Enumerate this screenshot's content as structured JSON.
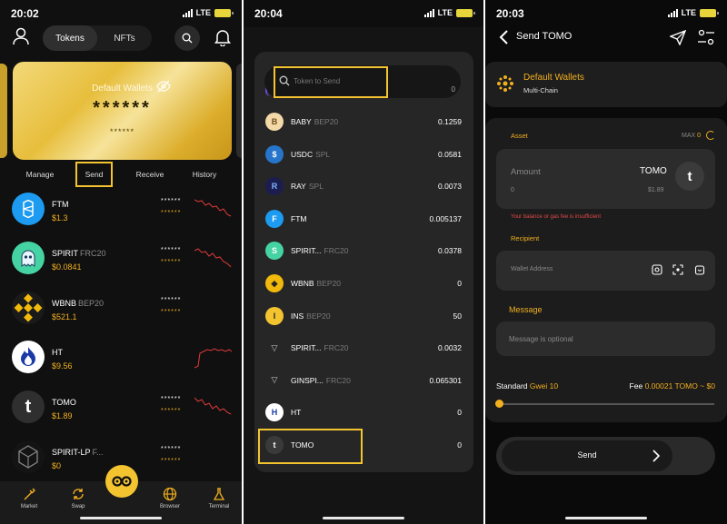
{
  "screen1": {
    "status": {
      "time": "20:02",
      "network": "LTE"
    },
    "tabs": [
      {
        "label": "Tokens"
      },
      {
        "label": "NFTs"
      }
    ],
    "card": {
      "wallet_name": "Default Wallets",
      "balance_mask": "******",
      "sub_mask": "******"
    },
    "actions": [
      {
        "label": "Manage"
      },
      {
        "label": "Send"
      },
      {
        "label": "Receive"
      },
      {
        "label": "History"
      }
    ],
    "tokens": [
      {
        "name": "FTM",
        "standard": "",
        "price": "$1.3",
        "mask1": "******",
        "mask2": "******",
        "logo_color": "#1c9bf0",
        "logo_text": "F"
      },
      {
        "name": "SPIRIT",
        "standard": "FRC20",
        "price": "$0.0841",
        "mask1": "******",
        "mask2": "******",
        "logo_color": "#45d3a3",
        "logo_text": "S"
      },
      {
        "name": "WBNB",
        "standard": "BEP20",
        "price": "$521.1",
        "mask1": "******",
        "mask2": "******",
        "logo_color": "#f0b90b",
        "logo_text": "◆"
      },
      {
        "name": "HT",
        "standard": "",
        "price": "$9.56",
        "mask1": "******",
        "mask2": "******",
        "logo_color": "#ffffff",
        "logo_text": "H"
      },
      {
        "name": "TOMO",
        "standard": "",
        "price": "$1.89",
        "mask1": "******",
        "mask2": "******",
        "logo_color": "#2f2f2f",
        "logo_text": "t"
      },
      {
        "name": "SPIRIT-LP",
        "standard": "F...",
        "price": "$0",
        "mask1": "******",
        "mask2": "******",
        "logo_color": "#1a1a1a",
        "logo_text": "⬡"
      }
    ],
    "nav": [
      {
        "label": "Market"
      },
      {
        "label": "Swap"
      },
      {
        "label": "Browser"
      },
      {
        "label": "Terminal"
      }
    ],
    "fab_icon": "tomo-logo-icon"
  },
  "screen2": {
    "status": {
      "time": "20:04",
      "network": "LTE"
    },
    "search": {
      "placeholder": "Token to Send",
      "edge_value": "0"
    },
    "rows": [
      {
        "name": "BABY",
        "standard": "BEP20",
        "balance": "0.1259",
        "icon_bg": "#f4d9a8",
        "icon_text": "B",
        "icon_fg": "#6b4b1a"
      },
      {
        "name": "USDC",
        "standard": "SPL",
        "balance": "0.0581",
        "icon_bg": "#2775ca",
        "icon_text": "$",
        "icon_fg": "#ffffff"
      },
      {
        "name": "RAY",
        "standard": "SPL",
        "balance": "0.0073",
        "icon_bg": "#1b1d4e",
        "icon_text": "R",
        "icon_fg": "#7fb6ff"
      },
      {
        "name": "FTM",
        "standard": "",
        "balance": "0.005137",
        "icon_bg": "#1c9bf0",
        "icon_text": "F",
        "icon_fg": "#ffffff"
      },
      {
        "name": "SPIRIT...",
        "standard": "FRC20",
        "balance": "0.0378",
        "icon_bg": "#45d3a3",
        "icon_text": "S",
        "icon_fg": "#ffffff"
      },
      {
        "name": "WBNB",
        "standard": "BEP20",
        "balance": "0",
        "icon_bg": "#f0b90b",
        "icon_text": "◆",
        "icon_fg": "#262626"
      },
      {
        "name": "INS",
        "standard": "BEP20",
        "balance": "50",
        "icon_bg": "#f4c430",
        "icon_text": "I",
        "icon_fg": "#262626"
      },
      {
        "name": "SPIRIT...",
        "standard": "FRC20",
        "balance": "0.0032",
        "icon_bg": "#262626",
        "icon_text": "▽",
        "icon_fg": "#888888"
      },
      {
        "name": "GINSPI...",
        "standard": "FRC20",
        "balance": "0.065301",
        "icon_bg": "#262626",
        "icon_text": "▽",
        "icon_fg": "#888888"
      },
      {
        "name": "HT",
        "standard": "",
        "balance": "0",
        "icon_bg": "#ffffff",
        "icon_text": "H",
        "icon_fg": "#1a3aa8"
      },
      {
        "name": "TOMO",
        "standard": "",
        "balance": "0",
        "icon_bg": "#3a3a3a",
        "icon_text": "t",
        "icon_fg": "#ffffff"
      }
    ]
  },
  "screen3": {
    "status": {
      "time": "20:03",
      "network": "LTE"
    },
    "title": "Send TOMO",
    "wallet": {
      "name": "Default Wallets",
      "chain": "Multi-Chain"
    },
    "asset_label": "Asset",
    "max_label": "MAX",
    "max_value": "0",
    "amount": {
      "label": "Amount",
      "value": "0",
      "token": "TOMO",
      "balance": "$1.89"
    },
    "error": "Your balance or gas fee is insufficient",
    "recipient_label": "Recipient",
    "address_placeholder": "Wallet Address",
    "message_label": "Message",
    "message_placeholder": "Message is optional",
    "fee": {
      "speed": "Standard",
      "gwei": "Gwei 10",
      "fee_label": "Fee",
      "fee_value": "0.00021 TOMO ~ $0",
      "slider_level": 0
    },
    "send_label": "Send"
  }
}
